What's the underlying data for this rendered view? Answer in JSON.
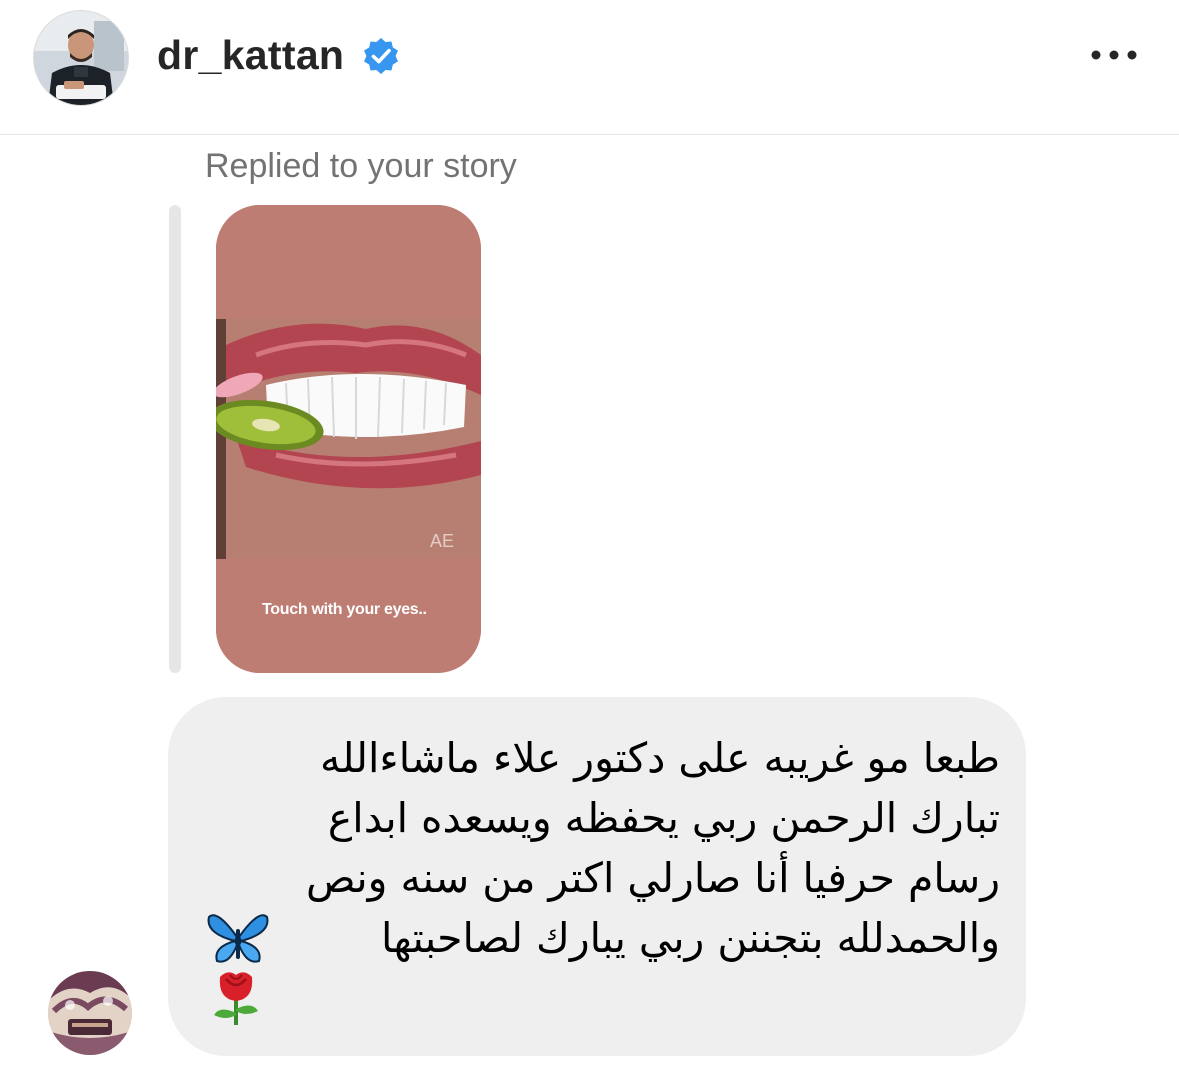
{
  "header": {
    "username": "dr_kattan",
    "verified": true,
    "avatar_icon": "profile-photo",
    "more_icon": "more-horizontal-icon"
  },
  "thread": {
    "replied_label": "Replied to your story",
    "story": {
      "caption": "Touch with your eyes..",
      "watermark": "AE",
      "background_color": "#be7d73"
    },
    "message": {
      "lines": [
        "طبعا مو غريبه على دكتور علاء ماشاءالله",
        "تبارك الرحمن ربي يحفظه ويسعده ابداع",
        "رسام حرفيا أنا صارلي اكتر من سنه ونص",
        "والحمدلله بتجننن ربي يبارك لصاحبتها"
      ],
      "emojis": [
        "butterfly-emoji",
        "rose-emoji"
      ],
      "bubble_color": "#efefef"
    },
    "sender_avatar_icon": "sender-profile-photo"
  },
  "colors": {
    "verified_blue": "#3797f0",
    "muted_text": "#737373",
    "divider": "#e6e6e6"
  }
}
